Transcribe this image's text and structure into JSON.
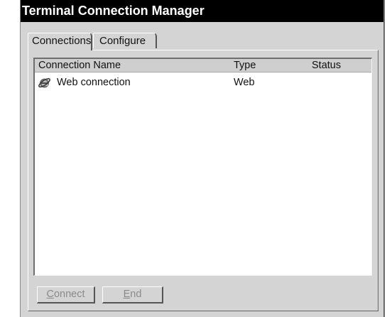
{
  "window": {
    "title": "Terminal Connection Manager"
  },
  "tabs": [
    {
      "label": "Connections",
      "selected": true
    },
    {
      "label": "Configure",
      "selected": false
    }
  ],
  "list": {
    "columns": [
      "Connection Name",
      "Type",
      "Status"
    ],
    "rows": [
      {
        "name": "Web connection",
        "type": "Web",
        "status": "",
        "icon": "internet-explorer-icon"
      }
    ]
  },
  "buttons": {
    "connect": {
      "mnemonic": "C",
      "rest": "onnect",
      "enabled": false
    },
    "end": {
      "mnemonic": "E",
      "rest": "nd",
      "enabled": false
    }
  }
}
